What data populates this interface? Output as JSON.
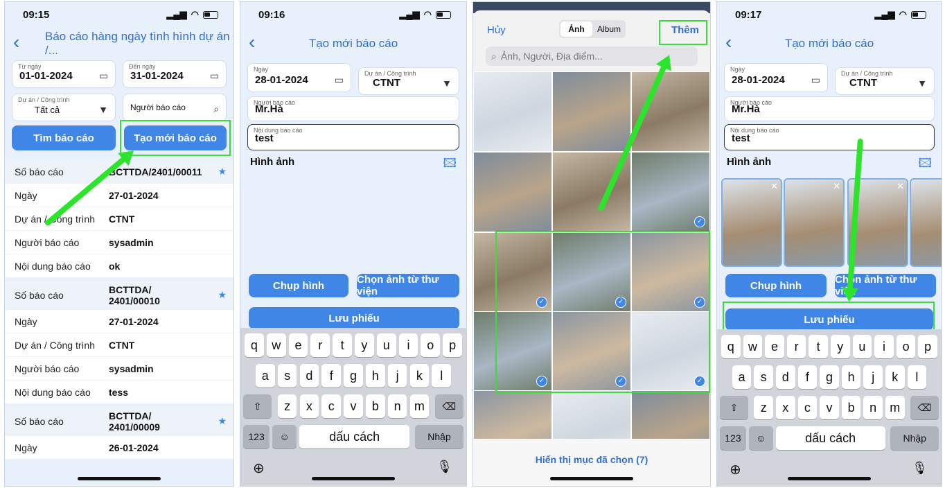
{
  "s1": {
    "time": "09:15",
    "title": "Báo cáo hàng ngày tình hình dự án /...",
    "from_label": "Từ ngày",
    "from_value": "01-01-2024",
    "to_label": "Đến ngày",
    "to_value": "31-01-2024",
    "project_label": "Dự án / Công trình",
    "project_value": "Tất cả",
    "reporter_placeholder": "Người báo cáo",
    "search_button": "Tìm báo cáo",
    "create_button": "Tạo mới báo cáo",
    "reports": [
      {
        "rows": [
          {
            "k": "Số báo cáo",
            "v": "BCTTDA/2401/00011"
          },
          {
            "k": "Ngày",
            "v": "27-01-2024"
          },
          {
            "k": "Dự án / Công trình",
            "v": "CTNT"
          },
          {
            "k": "Người báo cáo",
            "v": "sysadmin"
          },
          {
            "k": "Nội dung báo cáo",
            "v": "ok"
          }
        ]
      },
      {
        "rows": [
          {
            "k": "Số báo cáo",
            "v": "BCTTDA/\n2401/00010"
          },
          {
            "k": "Ngày",
            "v": "27-01-2024"
          },
          {
            "k": "Dự án / Công trình",
            "v": "CTNT"
          },
          {
            "k": "Người báo cáo",
            "v": "sysadmin"
          },
          {
            "k": "Nội dung báo cáo",
            "v": "tess"
          }
        ]
      },
      {
        "rows": [
          {
            "k": "Số báo cáo",
            "v": "BCTTDA/\n2401/00009"
          },
          {
            "k": "Ngày",
            "v": "26-01-2024"
          }
        ]
      }
    ]
  },
  "s2": {
    "time": "09:16",
    "title": "Tạo mới báo cáo",
    "date_label": "Ngày",
    "date_value": "28-01-2024",
    "project_label": "Dự án / Công trình",
    "project_value": "CTNT",
    "reporter_label": "Người báo cáo",
    "reporter_value": "Mr.Hà",
    "content_label": "Nội dung báo cáo",
    "content_value": "test",
    "images_label": "Hình ảnh",
    "camera_button": "Chụp hình",
    "library_button": "Chọn ảnh từ thư viện",
    "save_button": "Lưu phiếu"
  },
  "kbd": {
    "row1": [
      "q",
      "w",
      "e",
      "r",
      "t",
      "y",
      "u",
      "i",
      "o",
      "p"
    ],
    "row2": [
      "a",
      "s",
      "d",
      "f",
      "g",
      "h",
      "j",
      "k",
      "l"
    ],
    "row3": [
      "z",
      "x",
      "c",
      "v",
      "b",
      "n",
      "m"
    ],
    "num": "123",
    "space": "dấu cách",
    "enter": "Nhập"
  },
  "s3": {
    "cancel": "Hủy",
    "tab_photos": "Ảnh",
    "tab_album": "Album",
    "add": "Thêm",
    "search_placeholder": "Ảnh, Người, Địa điểm...",
    "show_selected": "Hiển thị mục đã chọn (7)"
  },
  "s4": {
    "time": "09:17"
  },
  "colors": {
    "accent": "#3f86e6",
    "highlight": "#3ddc3d",
    "arrow": "#2de42d",
    "bg": "#e8f0fb"
  }
}
